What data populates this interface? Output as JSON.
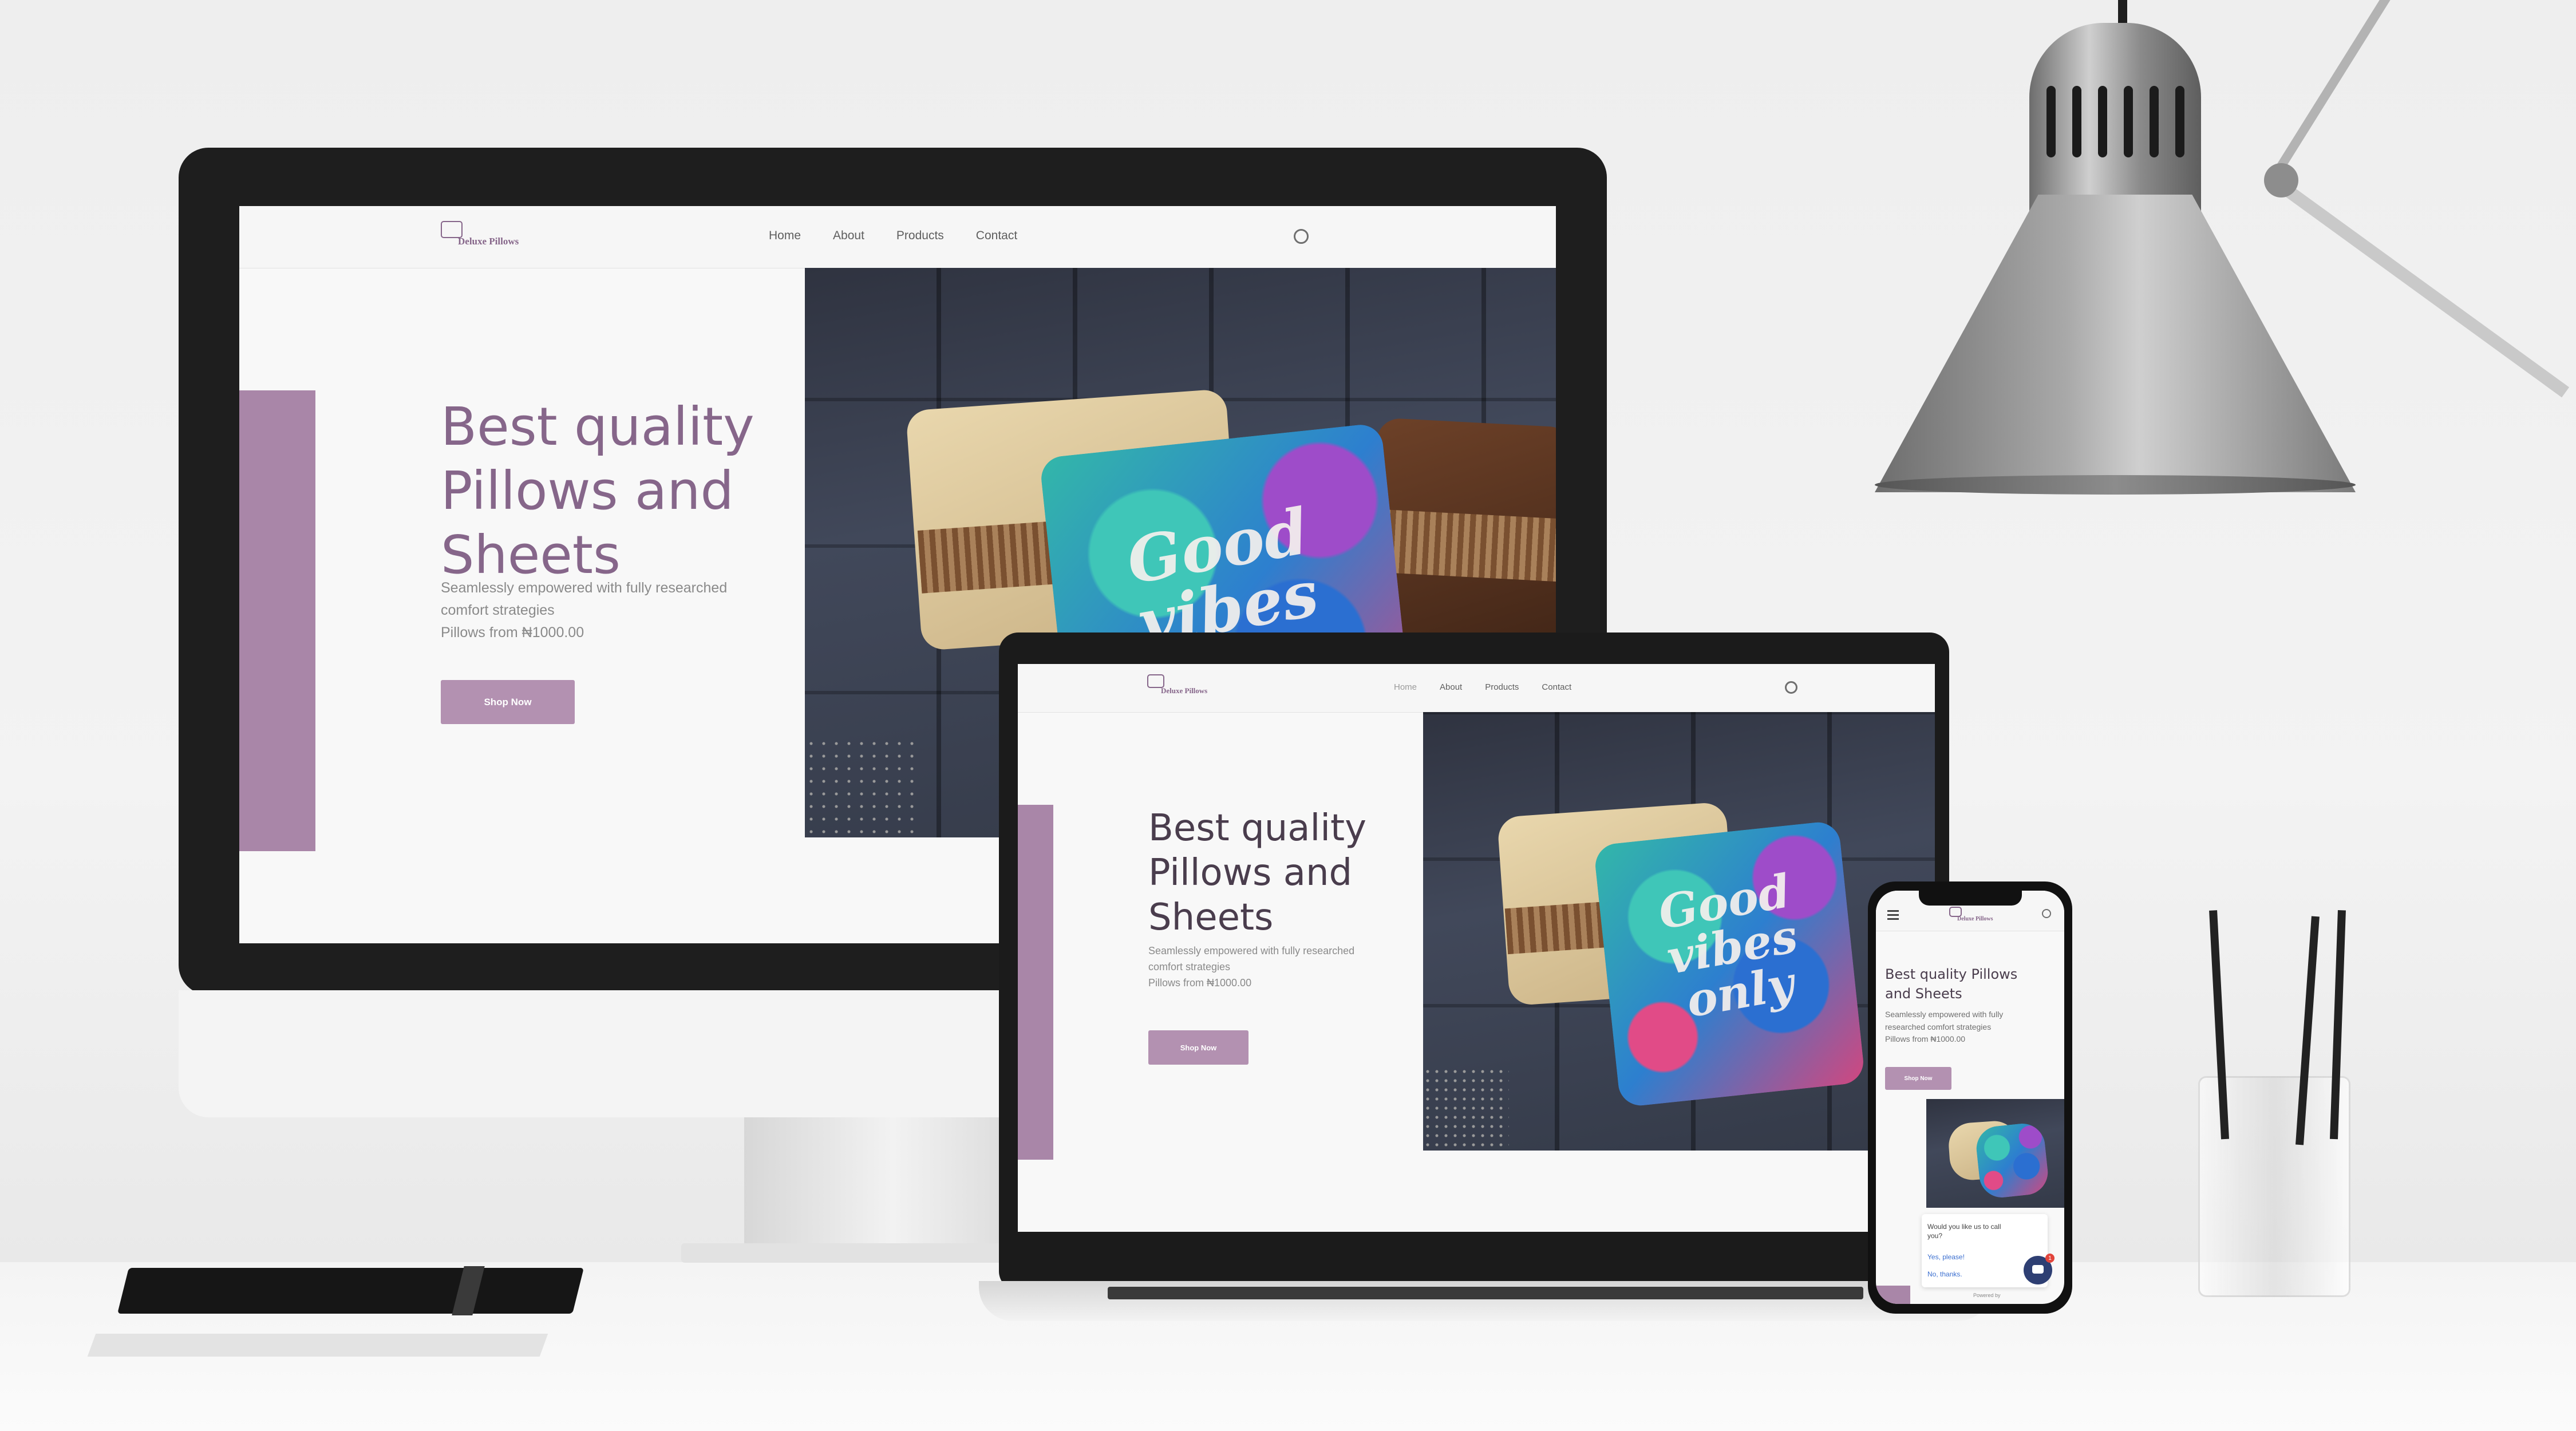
{
  "site": {
    "brand": "Deluxe Pillows",
    "menu": [
      "Home",
      "About",
      "Products",
      "Contact"
    ],
    "hero_title_line1": "Best quality",
    "hero_title_line2": "Pillows and",
    "hero_title_line3": "Sheets",
    "mobile_title_line1": "Best quality Pillows",
    "mobile_title_line2": "and Sheets",
    "subtitle_line1": "Seamlessly empowered with fully researched",
    "subtitle_line2": "comfort strategies",
    "mobile_sub_line1": "Seamlessly empowered with fully",
    "mobile_sub_line2": "researched comfort strategies",
    "price": "Pillows from ₦1000.00",
    "cta": "Shop Now",
    "pillow_text": "Good vibes only"
  },
  "chat": {
    "question": "Would you like us to call you?",
    "option_yes": "Yes, please!",
    "option_no": "No, thanks.",
    "powered_by": "Powered by",
    "badge_count": "1"
  },
  "colors": {
    "accent": "#a986a8",
    "brand_text": "#86668a",
    "button": "#b391b1"
  },
  "icons": [
    "search-icon",
    "logo-chat-icon",
    "hamburger-menu-icon",
    "chat-bubble-icon"
  ]
}
